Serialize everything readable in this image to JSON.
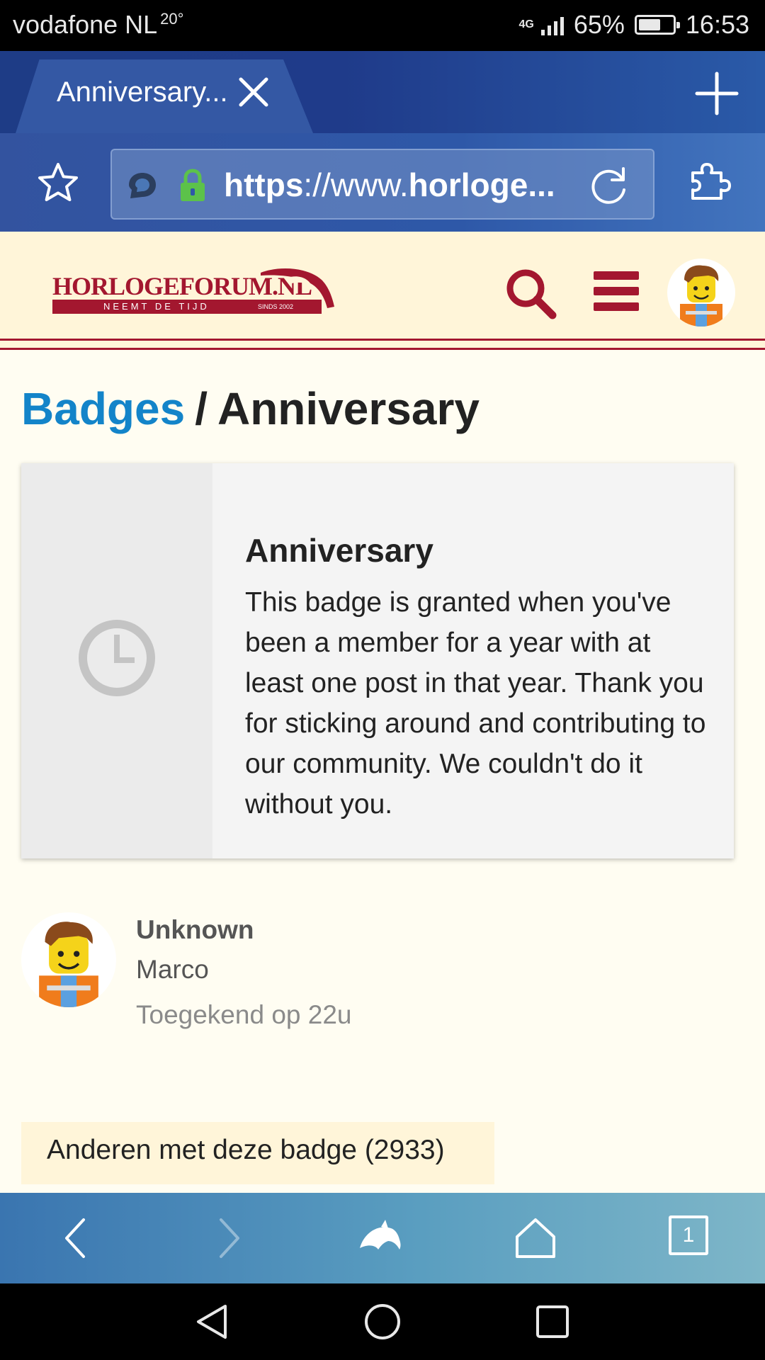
{
  "status_bar": {
    "carrier": "vodafone NL",
    "temperature": "20°",
    "network": "4G",
    "battery": "65%",
    "battery_level": 0.65,
    "time": "16:53"
  },
  "browser": {
    "tab_title": "Anniversary...",
    "url_scheme": "https",
    "url_rest": "://www.",
    "url_host": "horloge...",
    "tab_count": "1"
  },
  "site": {
    "logo_name": "HORLOGEFORUM.NL",
    "logo_tagline": "NEEMT DE TIJD",
    "logo_since": "SINDS 2002",
    "brand_color": "#a3172f"
  },
  "page": {
    "breadcrumb_link": "Badges",
    "separator": "/",
    "current": "Anniversary"
  },
  "badge": {
    "name": "Anniversary",
    "description": "This badge is granted when you've been a member for a year with at least one post in that year. Thank you for sticking around and contributing to our community. We couldn't do it without you.",
    "icon": "clock-icon"
  },
  "user": {
    "title": "Unknown",
    "name": "Marco",
    "granted": "Toegekend op 22u"
  },
  "others": {
    "label": "Anderen met deze badge (2933)"
  }
}
